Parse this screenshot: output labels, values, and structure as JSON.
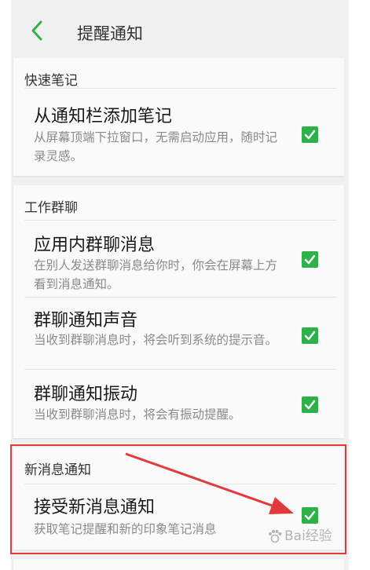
{
  "header": {
    "back_icon": "chevron-left-icon",
    "title": "提醒通知"
  },
  "sections": [
    {
      "title": "快速笔记",
      "items": [
        {
          "title": "从通知栏添加笔记",
          "desc": "从屏幕顶端下拉窗口，无需启动应用，随时记录灵感。",
          "checked": true
        }
      ]
    },
    {
      "title": "工作群聊",
      "items": [
        {
          "title": "应用内群聊消息",
          "desc": "在别人发送群聊消息给你时，你会在屏幕上方看到消息通知。",
          "checked": true
        },
        {
          "title": "群聊通知声音",
          "desc": "当收到群聊消息时，将会听到系统的提示音。",
          "checked": true
        },
        {
          "title": "群聊通知振动",
          "desc": "当收到群聊消息时，将会有振动提醒。",
          "checked": true
        }
      ]
    },
    {
      "title": "新消息通知",
      "items": [
        {
          "title": "接受新消息通知",
          "desc": "获取笔记提醒和新的印象笔记消息",
          "checked": true
        }
      ]
    }
  ],
  "colors": {
    "accent": "#2fb14a",
    "annotation": "#e23a3a"
  },
  "watermark": "Bai经验"
}
